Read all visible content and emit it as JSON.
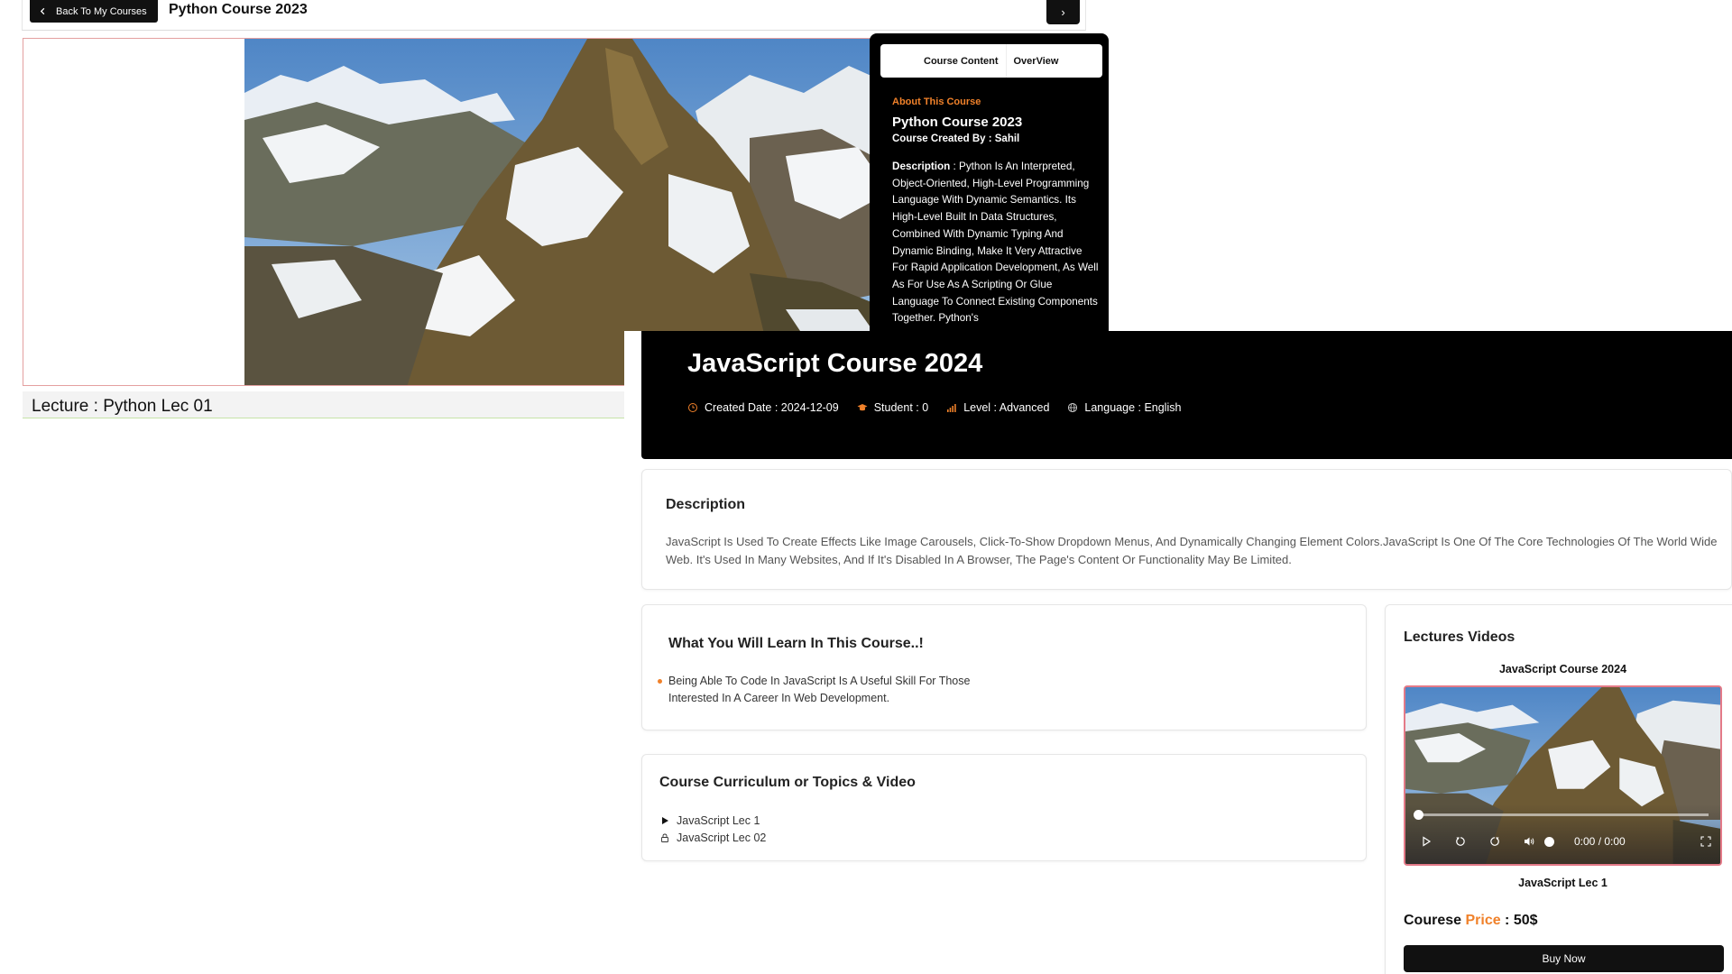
{
  "python_view": {
    "back_button": "Back To My Courses",
    "course_title": "Python Course 2023",
    "next_button": "›",
    "lecture_title": "Lecture : Python Lec 01",
    "tabs": [
      "Course Content",
      "OverView"
    ],
    "about": {
      "label": "About This Course",
      "title": "Python Course 2023",
      "author": "Course Created By : Sahil",
      "description_label": "Description",
      "description_text": " : Python Is An Interpreted, Object-Oriented, High-Level Programming Language With Dynamic Semantics. Its High-Level Built In Data Structures, Combined With Dynamic Typing And Dynamic Binding, Make It Very Attractive For Rapid Application Development, As Well As For Use As A Scripting Or Glue Language To Connect Existing Components Together. Python's"
    }
  },
  "js_view": {
    "hero": {
      "title": "JavaScript Course 2024",
      "created": "Created Date : 2024-12-09",
      "students": "Student : 0",
      "level": "Level : Advanced",
      "language": "Language : English"
    },
    "description": {
      "heading": "Description",
      "text": "JavaScript Is Used To Create Effects Like Image Carousels, Click-To-Show Dropdown Menus, And Dynamically Changing Element Colors.JavaScript Is One Of The Core Technologies Of The World Wide Web. It's Used In Many Websites, And If It's Disabled In A Browser, The Page's Content Or Functionality May Be Limited."
    },
    "learn": {
      "heading": "What You Will Learn In This Course..!",
      "items": [
        "Being Able To Code In JavaScript Is A Useful Skill For Those Interested In A Career In Web Development."
      ]
    },
    "curriculum": {
      "heading": "Course Curriculum or Topics & Video",
      "items": [
        {
          "label": "JavaScript Lec 1",
          "icon": "play-icon"
        },
        {
          "label": "JavaScript Lec 02",
          "icon": "lock-icon"
        }
      ]
    },
    "lectures": {
      "heading": "Lectures Videos",
      "course_name": "JavaScript Course 2024",
      "time": "0:00 / 0:00",
      "lecture_name": "JavaScript Lec 1",
      "price_prefix": "Courese ",
      "price_word": "Price",
      "price_value": " : 50$",
      "buy_button": "Buy Now"
    }
  },
  "colors": {
    "accent": "#f0812a",
    "dark": "#000000",
    "player_border": "#e47a88"
  }
}
